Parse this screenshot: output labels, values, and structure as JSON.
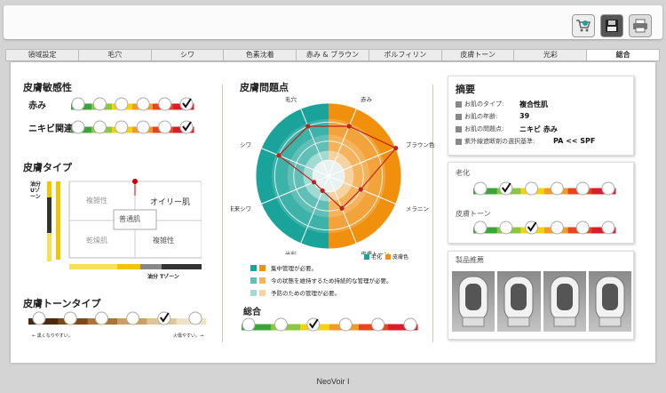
{
  "tabs": [
    "領域設定",
    "毛穴",
    "シワ",
    "色素沈着",
    "赤み & ブラウン",
    "ポルフィリン",
    "皮膚トーン",
    "光彩",
    "総合"
  ],
  "active_tab": 8,
  "left": {
    "sensitivity": {
      "title": "皮膚敏感性",
      "rows": [
        {
          "label": "赤み",
          "checked_index": 5
        },
        {
          "label": "ニキビ関連",
          "checked_index": 5
        }
      ]
    },
    "skin_type": {
      "title": "皮膚タイプ",
      "y_axis": "油分 Uゾーン",
      "x_axis": "油分 Tゾーン",
      "cells": {
        "top_left": "複雑性",
        "top_right": "オイリー肌",
        "center": "普通肌",
        "bottom_left": "乾燥肌",
        "bottom_right": "複雑性"
      }
    },
    "tone_type": {
      "title": "皮膚トーンタイプ",
      "checked_index": 4,
      "left_caption": "← 黒くなりやすい。",
      "right_caption": "火傷やすい。→"
    }
  },
  "radar": {
    "title": "皮膚問題点",
    "axes": [
      "毛穴",
      "赤み",
      "ブラウン色素",
      "メラニン",
      "皮膚トーン",
      "光彩",
      "未来シワ",
      "シワ"
    ],
    "legend_colors": [
      {
        "label": "老化",
        "color": "#1aa39a"
      },
      {
        "label": "皮膚色",
        "color": "#f0900d"
      }
    ],
    "scale_steps": 4,
    "values": [
      3,
      3,
      4,
      2,
      2,
      1,
      1,
      3
    ],
    "notes": [
      "集中管理が必要。",
      "今の状態を維持するため持続的な管理が必要。",
      "予防のための管理が必要。"
    ]
  },
  "overall": {
    "title": "総合",
    "checked_index": 2
  },
  "summary": {
    "title": "摘要",
    "rows": [
      {
        "k": "お肌のタイプ:",
        "v": "複合性肌"
      },
      {
        "k": "お肌の年齢:",
        "v": "39"
      },
      {
        "k": "お肌の問題点:",
        "v": "ニキビ 赤み"
      },
      {
        "k": "紫外線遮断剤の選択基準:",
        "v": "PA << SPF"
      }
    ]
  },
  "aging": {
    "title": "老化",
    "checked_index": 1
  },
  "skin_tone": {
    "title": "皮膚トーン",
    "checked_index": 2
  },
  "products": {
    "title": "製品推薦",
    "count": 4
  },
  "footer": "NeoVoir I",
  "icons": [
    "cart-add-icon",
    "save-disk-icon",
    "printer-icon",
    "check-icon"
  ]
}
